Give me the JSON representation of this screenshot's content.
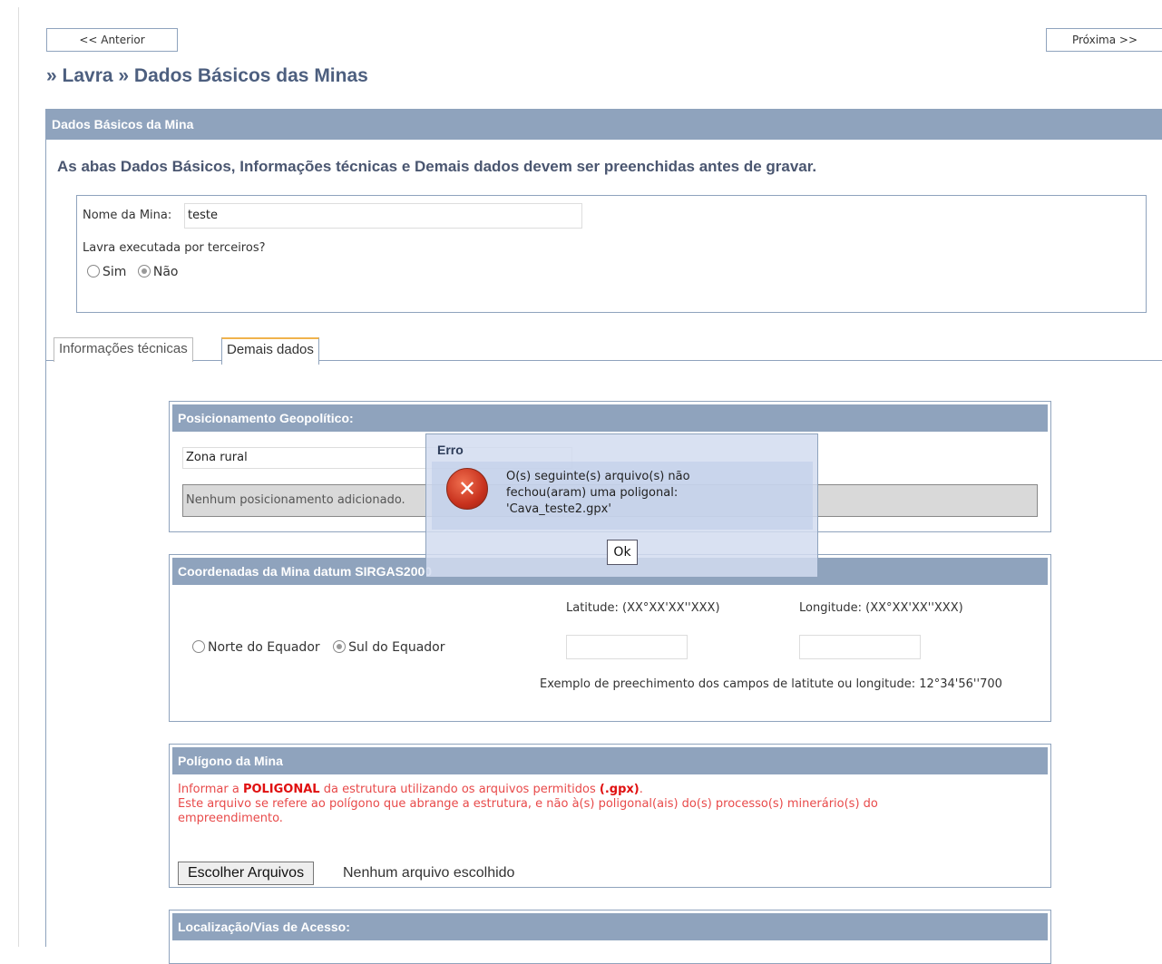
{
  "nav": {
    "prev_label": "<< Anterior",
    "next_label": "Próxima >>"
  },
  "page_title": "» Lavra » Dados Básicos das Minas",
  "main_panel": {
    "header": "Dados Básicos da Mina",
    "notice": "As abas Dados Básicos, Informações técnicas e Demais dados devem ser preenchidas antes de gravar."
  },
  "basic": {
    "mine_name_label": "Nome da Mina:",
    "mine_name_value": "teste",
    "third_party_label": "Lavra executada por terceiros?",
    "opt_yes": "Sim",
    "opt_no": "Não",
    "selected": "Não"
  },
  "tabs": [
    {
      "label": "Informações técnicas"
    },
    {
      "label": "Demais dados",
      "active": true
    }
  ],
  "geo": {
    "header": "Posicionamento Geopolítico:",
    "select_value": "Zona rural",
    "empty_text": "Nenhum posicionamento adicionado."
  },
  "coords": {
    "header": "Coordenadas da Mina datum SIRGAS2000",
    "lat_label": "Latitude: (XX°XX'XX''XXX)",
    "lon_label": "Longitude: (XX°XX'XX''XXX)",
    "opt_north": "Norte do Equador",
    "opt_south": "Sul do Equador",
    "selected": "Sul do Equador",
    "example": "Exemplo de preechimento dos campos de latitute ou longitude: 12°34'56''700"
  },
  "polygon": {
    "header": "Polígono da Mina",
    "line1_pre": "Informar a ",
    "line1_bold": "POLIGONAL",
    "line1_mid": " da estrutura utilizando os arquivos permitidos ",
    "line1_ext": "(.gpx)",
    "line1_end": ".",
    "line2": "Este arquivo se refere ao polígono que abrange a estrutura, e não à(s) poligonal(ais) do(s) processo(s) minerário(s) do empreendimento.",
    "file_button": "Escolher Arquivos",
    "file_status": "Nenhum arquivo escolhido"
  },
  "access": {
    "header": "Localização/Vias de Acesso:"
  },
  "dialog": {
    "title": "Erro",
    "line1": "O(s) seguinte(s) arquivo(s) não",
    "line2": "fechou(aram) uma poligonal:",
    "line3": "'Cava_teste2.gpx'",
    "ok_label": "Ok"
  },
  "colors": {
    "header_bg": "#8fa3bd",
    "title": "#4d5f7f",
    "warning_red": "#e01010",
    "tab_accent": "#f0b34c"
  }
}
